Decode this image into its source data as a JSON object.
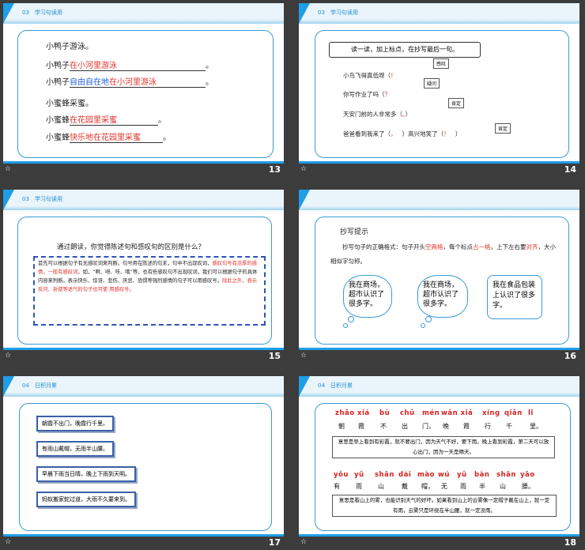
{
  "colors": {
    "accent": "#1e9ee6",
    "red": "#e0322b",
    "blue": "#1f5fd6",
    "background": "#3c3c3c"
  },
  "thumbs": [
    {
      "num": "13",
      "section_num": "03",
      "section_title": "学习句读用",
      "lines": [
        {
          "prefix": "小鸭子游泳。"
        },
        {
          "prefix": "小鸭子",
          "fill_red": "在小河里游泳",
          "suffix": "。"
        },
        {
          "prefix": "小鸭子",
          "fill_blue": "自由自在地",
          "fill_red": "在小河里游泳",
          "suffix": "。"
        },
        {
          "prefix": "小蜜蜂采蜜。"
        },
        {
          "prefix": "小蜜蜂",
          "fill_red": "在花园里采蜜",
          "suffix": "。"
        },
        {
          "prefix": "小蜜蜂",
          "fill_red": "快乐地在花园里采蜜",
          "suffix": "。"
        }
      ]
    },
    {
      "num": "14",
      "section_num": "03",
      "section_title": "学习句读用",
      "banner": "读一读，加上标点，在抄写最后一句。",
      "sentences": [
        "小鸟飞得真低呀（",
        "你写作业了吗（",
        "天安门前的人非常多（",
        "爸爸看到我来了（",
        "）高兴地笑了（",
        "）"
      ],
      "marks": [
        "！",
        "？",
        "。",
        "，",
        "！"
      ],
      "callouts": [
        "感叹",
        "疑问",
        "肯定",
        "肯定"
      ]
    },
    {
      "num": "15",
      "section_num": "03",
      "section_title": "学习句读用",
      "question": "通过朗读，你觉得陈述句和感叹句的区别是什么？",
      "para_a": "首先可以根据句子有无感叹词来判断。句号用在陈述的句末，句中不出现叹词，",
      "para_red1": "感叹句号有浓厚的感情，一般有感叹词",
      "para_b": "，如，“啊、呀、哇、哦”等，也有些感叹句不出现叹词，我们可以根据句子的具体内容来判断。表示快乐、惊讶、悲伤、厌恶、恐惧等强烈感情的句子可以用感叹号。",
      "para_red2": "除此之外，表示反问、祈使等语气的句子也可使 用感叹号。"
    },
    {
      "num": "16",
      "title": "抄写提示",
      "tip_a": "抄写句子的正确格式：句子开头",
      "tip_red1": "空两格",
      "tip_b": "，每个标点",
      "tip_red2": "占一格",
      "tip_c": "，上下左右要",
      "tip_red3": "对齐",
      "tip_d": "，大小相似字匀称。",
      "clouds": [
        "我在商场，超市认识了很多字。",
        "我在商场，超市认识了很多字。",
        "我在食品包装上认识了很多字。"
      ]
    },
    {
      "num": "17",
      "section_num": "04",
      "section_title": "日积月累",
      "phrases": [
        "朝霞不出门，晚霞行千里。",
        "有雨山戴帽，无雨半山腰。",
        "早晨下雨当日晴，晚上下雨到天明。",
        "蚂蚁搬家蛇过道，大雨不久要来到。"
      ]
    },
    {
      "num": "18",
      "section_num": "04",
      "section_title": "日积月累",
      "pinyin1": [
        "zhāo xiá",
        "bù",
        "chū",
        "mén",
        "wǎn xiá",
        "xíng",
        "qiān",
        "lǐ"
      ],
      "hanzi1": [
        "朝",
        "霞",
        "不",
        "出",
        "门，",
        "晚",
        "霞",
        "行",
        "千",
        "里。"
      ],
      "meaning1": "意思是早上看到有彩霞，就不要出门，因为天气不好，要下雨，晚上看到彩霞，第二天可以放心出门，因为一天是晴天。",
      "pinyin2": [
        "yǒu",
        "yǔ",
        "shān",
        "dài",
        "mào",
        "wú",
        "yǔ",
        "bàn",
        "shān",
        "yāo"
      ],
      "hanzi2": [
        "有",
        "雨",
        "山",
        "戴",
        "帽，",
        "无",
        "雨",
        "半",
        "山",
        "腰。"
      ],
      "meaning2": "意思是看山上的雾，也能识别天气的好坏。如果看到山上的云雾像一定帽子戴在山上，就一定有雨，云雾只是环绕在半山腰，就一定没雨。"
    }
  ]
}
